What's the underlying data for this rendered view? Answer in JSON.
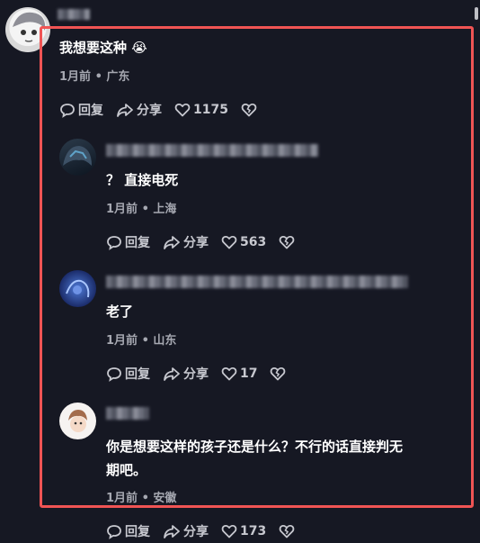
{
  "comments": [
    {
      "username": "",
      "text": "我想要这种 😭",
      "meta": "1月前 • 广东",
      "reply_label": "回复",
      "share_label": "分享",
      "likes": "1175"
    },
    {
      "username": "",
      "text": "？ 直接电死",
      "meta": "1月前 • 上海",
      "reply_label": "回复",
      "share_label": "分享",
      "likes": "563"
    },
    {
      "username": "",
      "text": "老了",
      "meta": "1月前 • 山东",
      "reply_label": "回复",
      "share_label": "分享",
      "likes": "17"
    },
    {
      "username": "",
      "text_line1": "你是想要这样的孩子还是什么？不行的话直接判无",
      "text_line2": "期吧。",
      "meta": "1月前 • 安徽",
      "reply_label": "回复",
      "share_label": "分享",
      "likes": "173"
    }
  ],
  "colors": {
    "background": "#161823",
    "highlight": "#f05454",
    "meta": "#a6a8b1"
  }
}
